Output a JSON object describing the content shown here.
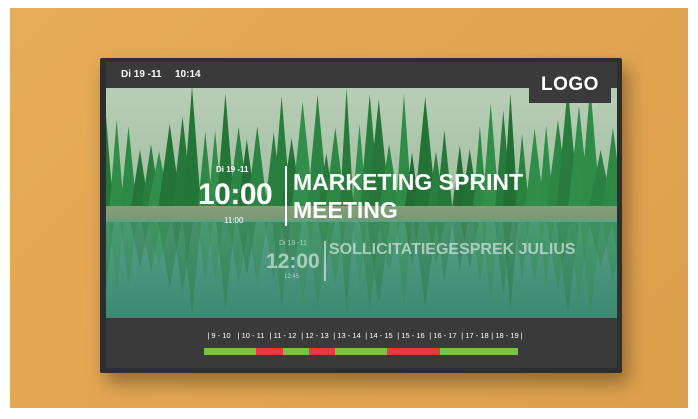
{
  "topbar": {
    "date": "Di 19 -11",
    "time": "10:14"
  },
  "logo": "LOGO",
  "current_event": {
    "date": "Di 19 -11",
    "start": "10:00",
    "end": "11:00",
    "title": "MARKETING SPRINT MEETING"
  },
  "next_event": {
    "date": "Di 19 -11",
    "start": "12:00",
    "end": "12:45",
    "title": "SOLLICITATIEGESPREK JULIUS"
  },
  "timeline": {
    "hours": [
      "| 9 - 10",
      "| 10 - 11",
      "| 11 - 12",
      "| 12 - 13",
      "| 13 - 14",
      "| 14 - 15",
      "| 15 - 16",
      "| 16 - 17",
      "| 17 - 18",
      "| 18 - 19 |"
    ],
    "slots": [
      "free",
      "free",
      "busy",
      "free",
      "busy",
      "free",
      "free",
      "busy",
      "busy",
      "free",
      "free",
      "free"
    ],
    "colors": {
      "free": "#7cc04b",
      "busy": "#e53b3b"
    }
  }
}
